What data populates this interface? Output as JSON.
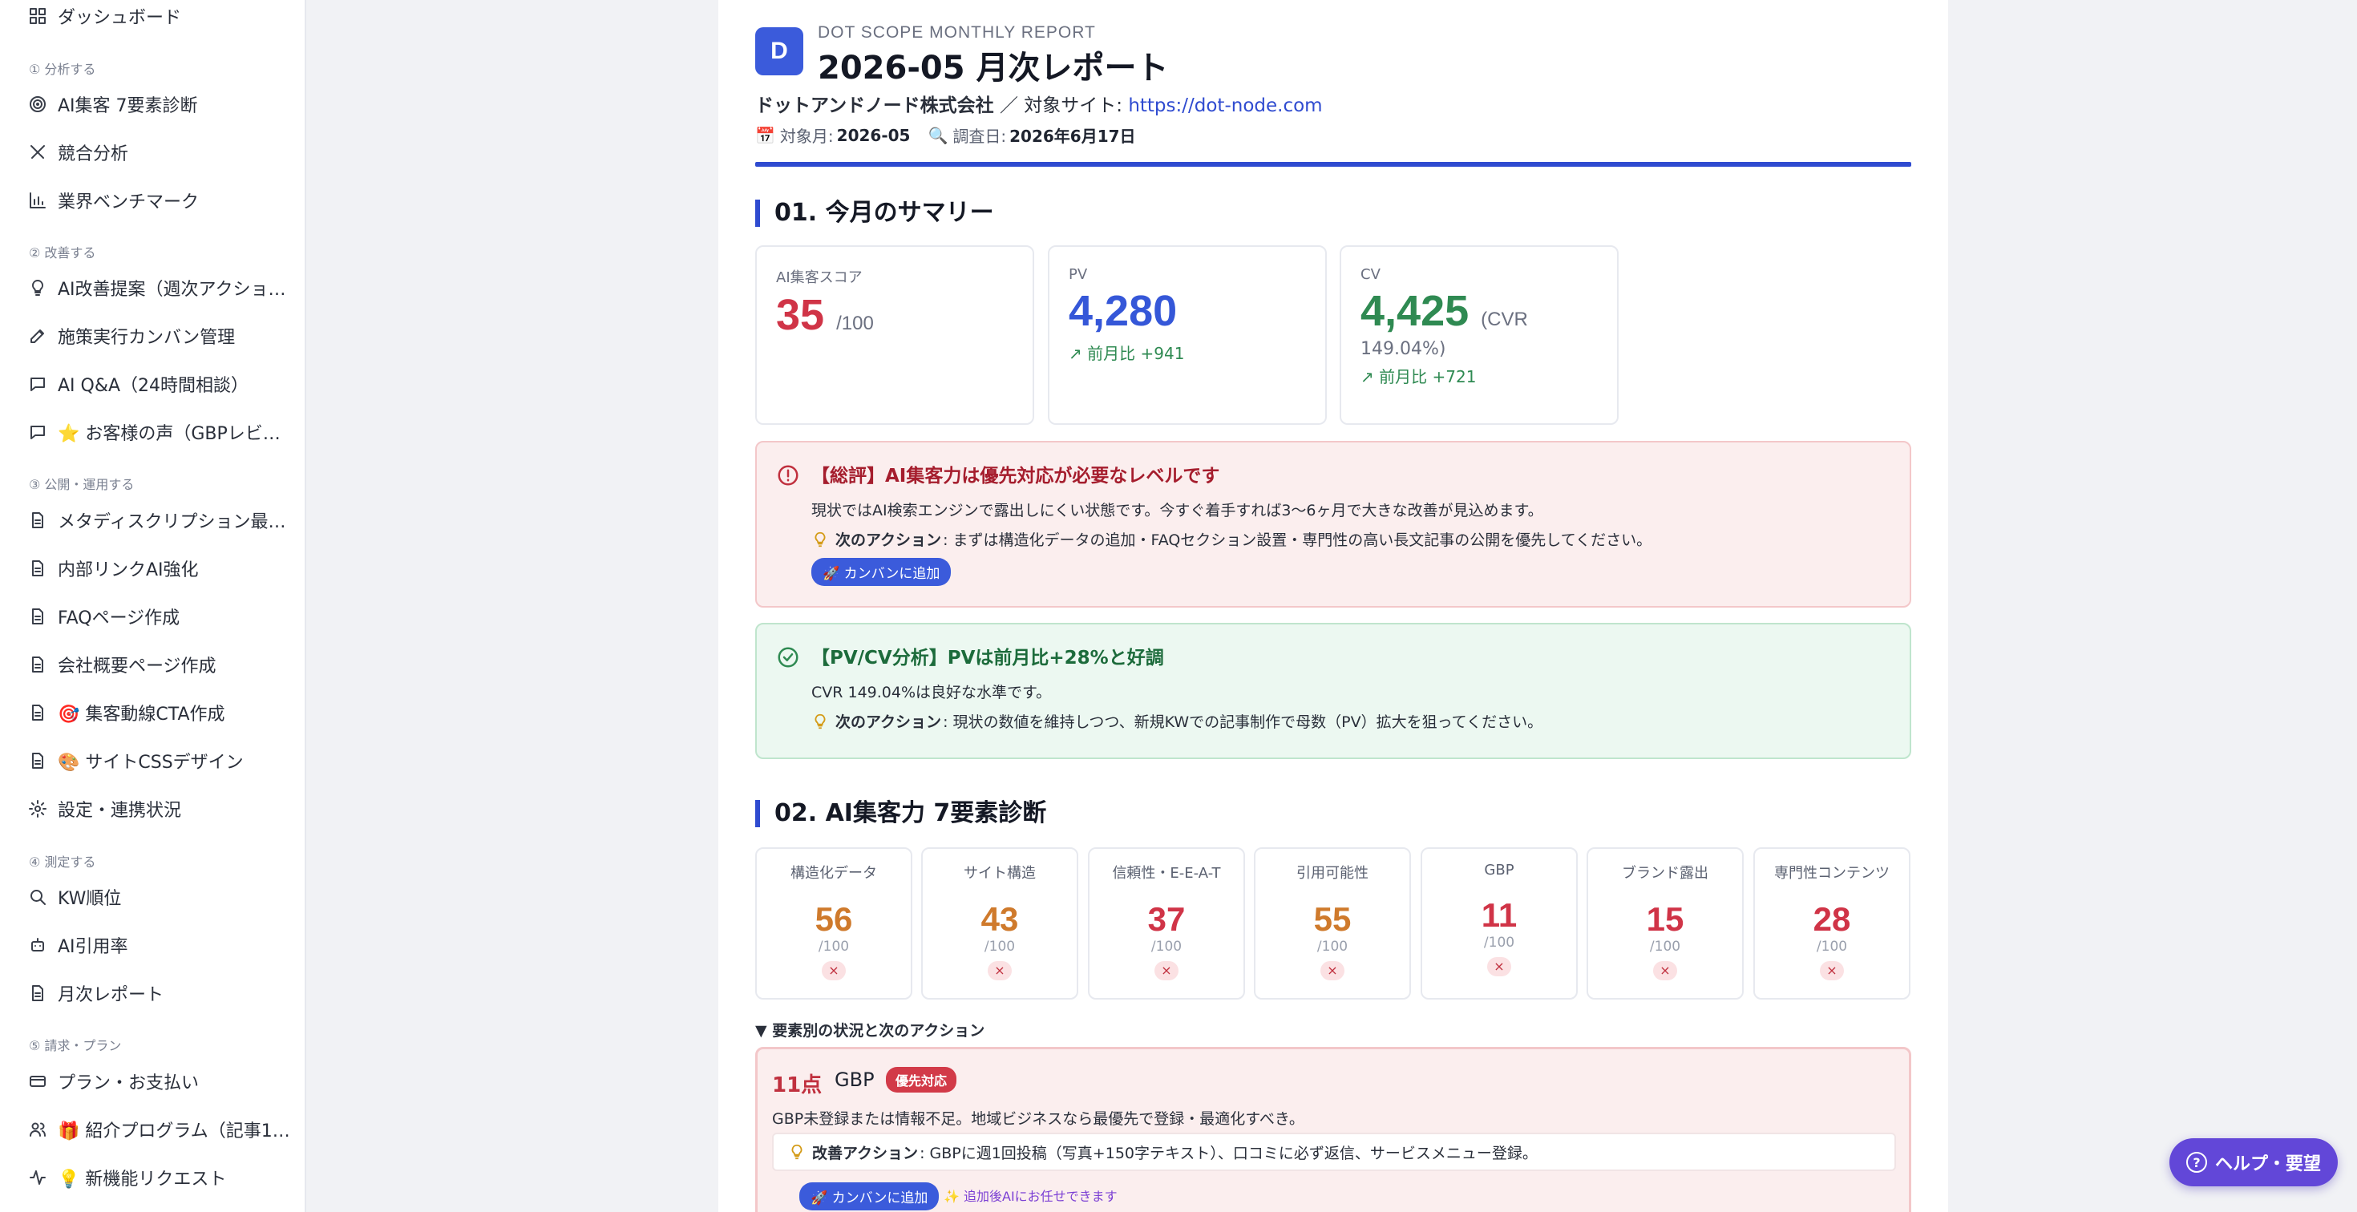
{
  "sidebar": {
    "items": [
      {
        "label": "ダッシュボード",
        "icon": "grid-icon"
      },
      {
        "label": "① 分析する",
        "type": "section"
      },
      {
        "label": "AI集客 7要素診断",
        "icon": "target-icon"
      },
      {
        "label": "競合分析",
        "icon": "swords-icon"
      },
      {
        "label": "業界ベンチマーク",
        "icon": "bar-chart-icon"
      },
      {
        "label": "② 改善する",
        "type": "section"
      },
      {
        "label": "AI改善提案（週次アクショ…",
        "icon": "lightbulb-icon"
      },
      {
        "label": "施策実行カンバン管理",
        "icon": "edit-icon"
      },
      {
        "label": "AI Q&A（24時間相談）",
        "icon": "chat-icon"
      },
      {
        "label": "⭐ お客様の声（GBPレビ…",
        "icon": "chat-icon"
      },
      {
        "label": "③ 公開・運用する",
        "type": "section"
      },
      {
        "label": "メタディスクリプション最…",
        "icon": "document-icon"
      },
      {
        "label": "内部リンクAI強化",
        "icon": "document-icon"
      },
      {
        "label": "FAQページ作成",
        "icon": "document-icon"
      },
      {
        "label": "会社概要ページ作成",
        "icon": "document-icon"
      },
      {
        "label": "🎯 集客動線CTA作成",
        "icon": "document-icon"
      },
      {
        "label": "🎨 サイトCSSデザイン",
        "icon": "document-icon"
      },
      {
        "label": "設定・連携状況",
        "icon": "gear-icon"
      },
      {
        "label": "④ 測定する",
        "type": "section"
      },
      {
        "label": "KW順位",
        "icon": "search-icon"
      },
      {
        "label": "AI引用率",
        "icon": "robot-icon"
      },
      {
        "label": "月次レポート",
        "icon": "document-icon"
      },
      {
        "label": "⑤ 請求・プラン",
        "type": "section"
      },
      {
        "label": "プラン・お支払い",
        "icon": "credit-card-icon"
      },
      {
        "label": "🎁 紹介プログラム（記事1…",
        "icon": "users-icon"
      },
      {
        "label": "💡 新機能リクエスト",
        "icon": "activity-icon"
      }
    ]
  },
  "header": {
    "logo_letter": "D",
    "eyebrow": "DOT SCOPE MONTHLY REPORT",
    "title": "2026-05 月次レポート",
    "company": "ドットアンドノード株式会社",
    "separator": "／ 対象サイト:",
    "site_url": "https://dot-node.com",
    "month_label": "対象月:",
    "month_value": "2026-05",
    "survey_label": "調査日:",
    "survey_value": "2026年6月17日"
  },
  "summary": {
    "heading": "01. 今月のサマリー",
    "kpis": [
      {
        "label": "AI集客スコア",
        "value": "35",
        "unit": "/100",
        "color": "#d03447"
      },
      {
        "label": "PV",
        "value": "4,280",
        "delta": "前月比 +941",
        "color": "#3557d8"
      },
      {
        "label": "CV",
        "value": "4,425",
        "unit": "(CVR",
        "unit2": "149.04%)",
        "delta": "前月比 +721",
        "color": "#2f8a52"
      }
    ],
    "alert_red": {
      "title": "【総評】AI集客力は優先対応が必要なレベルです",
      "body": "現状ではAI検索エンジンで露出しにくい状態です。今すぐ着手すれば3〜6ヶ月で大きな改善が見込めます。",
      "action_label": "次のアクション",
      "action_text": ": まずは構造化データの追加・FAQセクション設置・専門性の高い長文記事の公開を優先してください。",
      "button": "🚀 カンバンに追加"
    },
    "alert_green": {
      "title": "【PV/CV分析】PVは前月比+28%と好調",
      "body": "CVR 149.04%は良好な水準です。",
      "action_label": "次のアクション",
      "action_text": ": 現状の数値を維持しつつ、新規KWでの記事制作で母数（PV）拡大を狙ってください。"
    }
  },
  "diagnosis": {
    "heading": "02. AI集客力 7要素診断",
    "elements": [
      {
        "label": "構造化データ",
        "value": "56",
        "unit": "/100",
        "mark": "×",
        "color": "#cf7a2c"
      },
      {
        "label": "サイト構造",
        "value": "43",
        "unit": "/100",
        "mark": "×",
        "color": "#cf7a2c"
      },
      {
        "label": "信頼性・E-E-A-T",
        "value": "37",
        "unit": "/100",
        "mark": "×",
        "color": "#d03447"
      },
      {
        "label": "引用可能性",
        "value": "55",
        "unit": "/100",
        "mark": "×",
        "color": "#cf7a2c"
      },
      {
        "label": "GBP",
        "value": "11",
        "unit": "/100",
        "mark": "×",
        "color": "#d03447"
      },
      {
        "label": "ブランド露出",
        "value": "15",
        "unit": "/100",
        "mark": "×",
        "color": "#d03447"
      },
      {
        "label": "専門性コンテンツ",
        "value": "28",
        "unit": "/100",
        "mark": "×",
        "color": "#d03447"
      }
    ],
    "toggle": "▼ 要素別の状況と次のアクション",
    "detail": {
      "score": "11点",
      "name": "GBP",
      "badge": "優先対応",
      "desc": "GBP未登録または情報不足。地域ビジネスなら最優先で登録・最適化すべき。",
      "improve_label": "改善アクション",
      "improve_text": ": GBPに週1回投稿（写真+150字テキスト）、口コミに必ず返信、サービスメニュー登録。",
      "button": "🚀 カンバンに追加",
      "auto": "✨ 追加後AIにお任せできます"
    }
  },
  "help_button": "ヘルプ・要望"
}
